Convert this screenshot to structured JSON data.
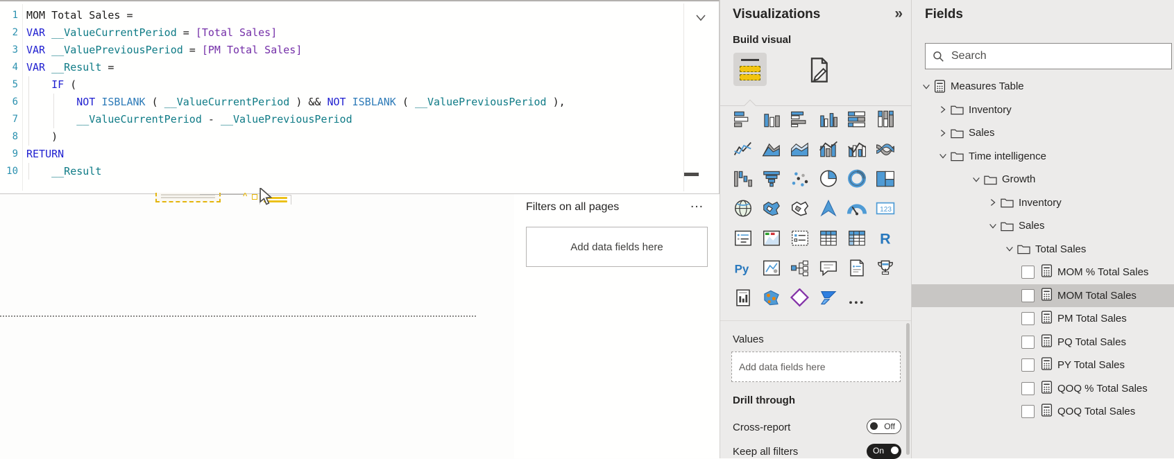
{
  "editor": {
    "lines": [
      {
        "n": 1,
        "s": [
          [
            "pl",
            "MOM Total Sales ="
          ]
        ]
      },
      {
        "n": 2,
        "s": [
          [
            "kw",
            "VAR"
          ],
          [
            "pl",
            " "
          ],
          [
            "vr",
            "__ValueCurrentPeriod"
          ],
          [
            "pl",
            " = "
          ],
          [
            "rf",
            "[Total Sales]"
          ]
        ]
      },
      {
        "n": 3,
        "s": [
          [
            "kw",
            "VAR"
          ],
          [
            "pl",
            " "
          ],
          [
            "vr",
            "__ValuePreviousPeriod"
          ],
          [
            "pl",
            " = "
          ],
          [
            "rf",
            "[PM Total Sales]"
          ]
        ]
      },
      {
        "n": 4,
        "s": [
          [
            "kw",
            "VAR"
          ],
          [
            "pl",
            " "
          ],
          [
            "vr",
            "__Result"
          ],
          [
            "pl",
            " ="
          ]
        ]
      },
      {
        "n": 5,
        "s": [
          [
            "pl",
            "    "
          ],
          [
            "kw",
            "IF"
          ],
          [
            "pl",
            " ("
          ]
        ]
      },
      {
        "n": 6,
        "s": [
          [
            "pl",
            "        "
          ],
          [
            "kw",
            "NOT"
          ],
          [
            "pl",
            " "
          ],
          [
            "fn",
            "ISBLANK"
          ],
          [
            "pl",
            " ( "
          ],
          [
            "vr",
            "__ValueCurrentPeriod"
          ],
          [
            "pl",
            " ) && "
          ],
          [
            "kw",
            "NOT"
          ],
          [
            "pl",
            " "
          ],
          [
            "fn",
            "ISBLANK"
          ],
          [
            "pl",
            " ( "
          ],
          [
            "vr",
            "__ValuePreviousPeriod"
          ],
          [
            "pl",
            " ),"
          ]
        ]
      },
      {
        "n": 7,
        "s": [
          [
            "pl",
            "        "
          ],
          [
            "vr",
            "__ValueCurrentPeriod"
          ],
          [
            "pl",
            " - "
          ],
          [
            "vr",
            "__ValuePreviousPeriod"
          ]
        ]
      },
      {
        "n": 8,
        "s": [
          [
            "pl",
            "    )"
          ]
        ]
      },
      {
        "n": 9,
        "s": [
          [
            "kw",
            "RETURN"
          ]
        ]
      },
      {
        "n": 10,
        "s": [
          [
            "pl",
            "    "
          ],
          [
            "vr",
            "__Result"
          ]
        ]
      }
    ],
    "syntax_colors": {
      "keyword": "#1f1fd0",
      "function": "#2e7bb8",
      "variable": "#0f7b86",
      "measure_ref": "#742fa8",
      "plain": "#1b1a19",
      "line_number": "#2b91af"
    }
  },
  "filters": {
    "title": "Filters on all pages",
    "more": "...",
    "dropzone": "Add data fields here"
  },
  "visualizations": {
    "title": "Visualizations",
    "collapse_icon": "»",
    "build_label": "Build visual",
    "tabs": [
      {
        "name": "build-visual",
        "selected": true
      },
      {
        "name": "format-visual",
        "selected": false
      }
    ],
    "gallery": [
      {
        "name": "stacked-bar-chart",
        "kind": "sbar"
      },
      {
        "name": "stacked-column-chart",
        "kind": "scol"
      },
      {
        "name": "clustered-bar-chart",
        "kind": "cbar"
      },
      {
        "name": "clustered-column-chart",
        "kind": "ccol"
      },
      {
        "name": "hundred-stacked-bar-chart",
        "kind": "pbar"
      },
      {
        "name": "hundred-stacked-column-chart",
        "kind": "pcol"
      },
      {
        "name": "line-chart",
        "kind": "line"
      },
      {
        "name": "area-chart",
        "kind": "area"
      },
      {
        "name": "stacked-area-chart",
        "kind": "sarea"
      },
      {
        "name": "line-stacked-column-chart",
        "kind": "combo1"
      },
      {
        "name": "line-clustered-column-chart",
        "kind": "combo2"
      },
      {
        "name": "ribbon-chart",
        "kind": "ribbon"
      },
      {
        "name": "waterfall-chart",
        "kind": "waterfall"
      },
      {
        "name": "funnel-chart",
        "kind": "funnel"
      },
      {
        "name": "scatter-chart",
        "kind": "scatter"
      },
      {
        "name": "pie-chart",
        "kind": "pie"
      },
      {
        "name": "donut-chart",
        "kind": "donut"
      },
      {
        "name": "treemap",
        "kind": "treemap"
      },
      {
        "name": "map",
        "kind": "globe"
      },
      {
        "name": "filled-map",
        "kind": "fmap"
      },
      {
        "name": "shape-map",
        "kind": "smap"
      },
      {
        "name": "azure-map",
        "kind": "amap"
      },
      {
        "name": "gauge",
        "kind": "gauge"
      },
      {
        "name": "card",
        "kind": "card123"
      },
      {
        "name": "multi-row-card",
        "kind": "mcard"
      },
      {
        "name": "kpi",
        "kind": "kpi"
      },
      {
        "name": "slicer",
        "kind": "slicer"
      },
      {
        "name": "table",
        "kind": "table"
      },
      {
        "name": "matrix",
        "kind": "matrix"
      },
      {
        "name": "r-script-visual",
        "kind": "rtxt"
      },
      {
        "name": "python-visual",
        "kind": "pytxt"
      },
      {
        "name": "key-influencers",
        "kind": "keyinf"
      },
      {
        "name": "decomposition-tree",
        "kind": "decomp"
      },
      {
        "name": "qa-visual",
        "kind": "qa"
      },
      {
        "name": "smart-narrative",
        "kind": "narr"
      },
      {
        "name": "metrics",
        "kind": "trophy"
      },
      {
        "name": "paginated-report",
        "kind": "pager"
      },
      {
        "name": "arcgis-map",
        "kind": "arcgis"
      },
      {
        "name": "power-apps-visual",
        "kind": "papps"
      },
      {
        "name": "power-automate-visual",
        "kind": "pauto"
      },
      {
        "name": "more-visuals",
        "kind": "dots"
      }
    ],
    "values_label": "Values",
    "values_dropzone": "Add data fields here",
    "drill_label": "Drill through",
    "cross_label": "Cross-report",
    "cross_state": "Off",
    "keep_label": "Keep all filters",
    "keep_state": "On",
    "accent_yellow": "#f2c40f"
  },
  "fields": {
    "title": "Fields",
    "search_placeholder": "Search",
    "tree": [
      {
        "label": "Measures Table",
        "type": "table",
        "chev": "v",
        "indent": 0
      },
      {
        "label": "Inventory",
        "type": "folder",
        "chev": ">",
        "indent": 1
      },
      {
        "label": "Sales",
        "type": "folder",
        "chev": ">",
        "indent": 1
      },
      {
        "label": "Time intelligence",
        "type": "folder",
        "chev": "v",
        "indent": 1
      },
      {
        "label": "Growth",
        "type": "folder",
        "chev": "v",
        "indent": 2
      },
      {
        "label": "Inventory",
        "type": "folder",
        "chev": ">",
        "indent": 3
      },
      {
        "label": "Sales",
        "type": "folder",
        "chev": "v",
        "indent": 3
      },
      {
        "label": "Total Sales",
        "type": "folder",
        "chev": "v",
        "indent": 4
      },
      {
        "label": "MOM % Total Sales",
        "type": "measure",
        "checkbox": true,
        "indent": 5,
        "selected": false
      },
      {
        "label": "MOM Total Sales",
        "type": "measure",
        "checkbox": true,
        "indent": 5,
        "selected": true
      },
      {
        "label": "PM Total Sales",
        "type": "measure",
        "checkbox": true,
        "indent": 5,
        "selected": false
      },
      {
        "label": "PQ Total Sales",
        "type": "measure",
        "checkbox": true,
        "indent": 5,
        "selected": false
      },
      {
        "label": "PY Total Sales",
        "type": "measure",
        "checkbox": true,
        "indent": 5,
        "selected": false
      },
      {
        "label": "QOQ % Total Sales",
        "type": "measure",
        "checkbox": true,
        "indent": 5,
        "selected": false
      },
      {
        "label": "QOQ Total Sales",
        "type": "measure",
        "checkbox": true,
        "indent": 5,
        "selected": false
      }
    ],
    "selected_row_color": "#c8c6c4"
  }
}
